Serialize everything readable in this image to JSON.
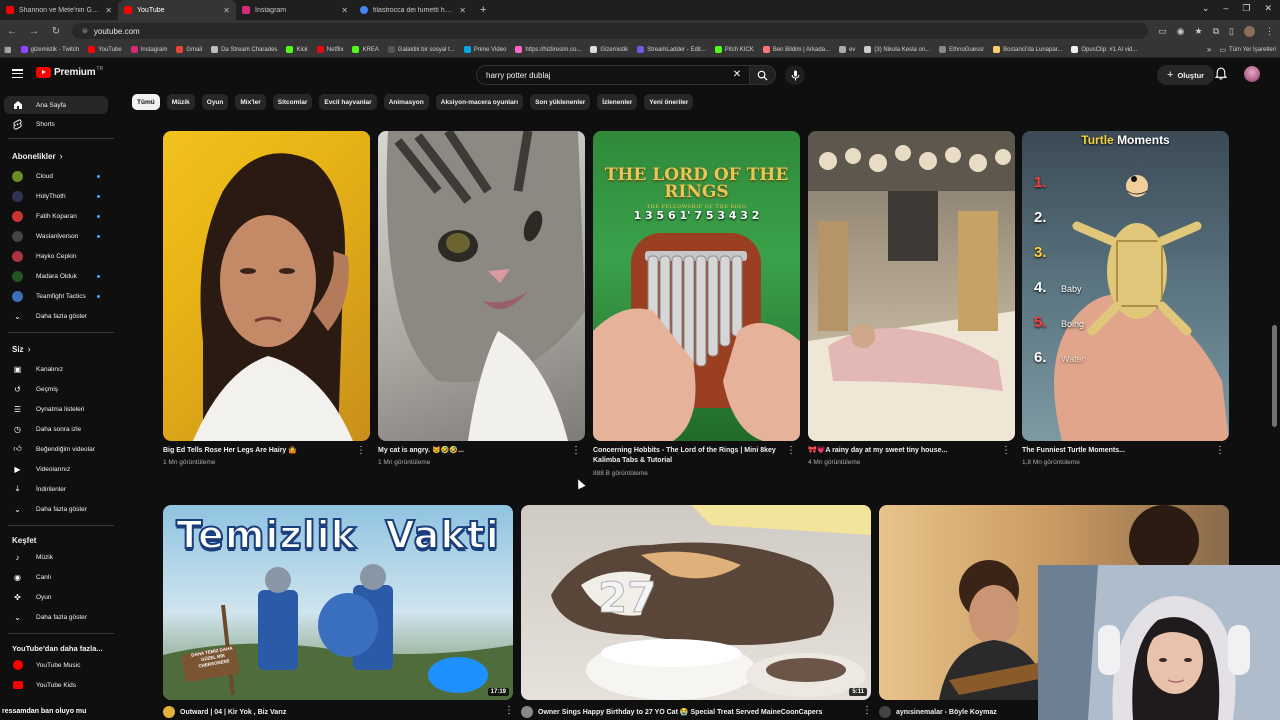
{
  "browser": {
    "tabs": [
      {
        "label": "Shannon ve Mete'nin Gece Ma",
        "color": "#ff0000"
      },
      {
        "label": "YouTube",
        "color": "#ff0000"
      },
      {
        "label": "Instagram",
        "color": "#d62976"
      },
      {
        "label": "filastrocca dei fumetti hangi di",
        "color": "#4285f4"
      }
    ],
    "url": "youtube.com",
    "bookmarks": [
      {
        "label": "gizemistik - Twitch",
        "color": "#9146ff"
      },
      {
        "label": "YouTube",
        "color": "#ff0000"
      },
      {
        "label": "Instagram",
        "color": "#d62976"
      },
      {
        "label": "Gmail",
        "color": "#ea4335"
      },
      {
        "label": "Da Stream Charades",
        "color": "#bbbbbb"
      },
      {
        "label": "Kick",
        "color": "#53fc18"
      },
      {
        "label": "Netflix",
        "color": "#e50914"
      },
      {
        "label": "KREA",
        "color": "#ffffff"
      },
      {
        "label": "Galaktik bir sosyal t...",
        "color": "#555555"
      },
      {
        "label": "Prime Video",
        "color": "#00a8e1"
      },
      {
        "label": "https://hizliresim.co...",
        "color": "#ff66cc"
      },
      {
        "label": "Gizemistik",
        "color": "#dddddd"
      },
      {
        "label": "StreamLadder - Edit...",
        "color": "#6c5ce7"
      },
      {
        "label": "Pitch KICK",
        "color": "#53fc18"
      },
      {
        "label": "Ben Bildim | Arkada...",
        "color": "#ff7675"
      },
      {
        "label": "ev",
        "color": "#aaaaaa"
      },
      {
        "label": "(3) Nikola Kesla on...",
        "color": "#cccccc"
      },
      {
        "label": "EthnoGuessr",
        "color": "#888888"
      },
      {
        "label": "Bostanci'da Lunapar...",
        "color": "#fdcb6e"
      },
      {
        "label": "OpusClip: #1 AI vid...",
        "color": "#eeeeee"
      }
    ],
    "bookmarks_all": "Tüm Yer İşaretleri"
  },
  "header": {
    "logo_text": "Premium",
    "logo_tm": "TR",
    "search_value": "harry potter dublaj",
    "create_label": "Oluştur"
  },
  "chips": [
    "Tümü",
    "Müzik",
    "Oyun",
    "Mix'ler",
    "Sitcomlar",
    "Evcil hayvanlar",
    "Animasyon",
    "Aksiyon-macera oyunları",
    "Son yüklenenler",
    "İzlenenler",
    "Yeni öneriler"
  ],
  "sidebar": {
    "home": "Ana Sayfa",
    "shorts": "Shorts",
    "subs_head": "Abonelikler",
    "subs": [
      {
        "label": "Cloud",
        "color": "#6b8e23"
      },
      {
        "label": "HolyThoth",
        "color": "#333355"
      },
      {
        "label": "Fatih Koparan",
        "color": "#cc3333"
      },
      {
        "label": "Waslanlverson",
        "color": "#444444"
      },
      {
        "label": "Hayko Cepkin",
        "color": "#aa3344"
      },
      {
        "label": "Madara Olduk",
        "color": "#225522"
      },
      {
        "label": "Teamfight Tactics",
        "color": "#3b6fb6"
      }
    ],
    "more": "Daha fazla göster",
    "you_head": "Siz",
    "you": [
      "Kanalınız",
      "Geçmiş",
      "Oynatma listeleri",
      "Daha sonra izle",
      "Beğendiğim videolar",
      "Videolarınız",
      "İndirilenler",
      "Daha fazla göster"
    ],
    "explore_head": "Keşfet",
    "explore": [
      "Müzik",
      "Canlı",
      "Oyun",
      "Daha fazla göster"
    ],
    "more_yt_head": "YouTube'dan daha fazla...",
    "more_yt": [
      "YouTube Music",
      "YouTube Kids"
    ]
  },
  "shorts": [
    {
      "title": "Big Ed Tells Rose Her Legs Are Hairy 🤷",
      "views": "1 Mn görüntüleme"
    },
    {
      "title": "My cat is angry. 😾🤣🤣...",
      "views": "1 Mn görüntüleme"
    },
    {
      "title": "Concerning Hobbits - The Lord of the Rings | Mini 8key Kalimba Tabs & Tutorial",
      "views": "888 B görüntüleme"
    },
    {
      "title": "🎀💗A rainy day at my sweet tiny house...",
      "views": "4 Mn görüntüleme"
    },
    {
      "title": "The Funniest Turtle Moments...",
      "views": "1,8 Mn görüntüleme"
    }
  ],
  "thumb_text": {
    "lotr_title": "THE LORD OF THE RINGS",
    "lotr_sub": "THE FELLOWSHIP OF THE RING",
    "lotr_numbers": "1 3 5 6 1' 7 5 3 4 3 2",
    "turtle_title_1": "Turtle",
    "turtle_title_2": "Moments",
    "turtle_list": [
      "1.",
      "2.",
      "3.",
      "4.",
      "5.",
      "6."
    ],
    "turtle_words": [
      "Baby",
      "Boing",
      "Water"
    ],
    "temizlik": "Temizlik  Vakti",
    "sign": "DAHA TEMİZ DAHA GÜZEL BİR CHERSONESE",
    "cake_number": "27"
  },
  "videos": [
    {
      "title": "Outward | 04 | Kir Yok , Biz Varız",
      "duration": "17:19"
    },
    {
      "title": "Owner Sings Happy Birthday to 27 YO Cat 😭 Special Treat Served MaineCoonCapers",
      "duration": "5:11"
    },
    {
      "title": "aynısinemalar - Böyle Koymaz",
      "duration": ""
    }
  ],
  "overlay": {
    "chat_text": "ressamdan ban oluyo mu"
  }
}
